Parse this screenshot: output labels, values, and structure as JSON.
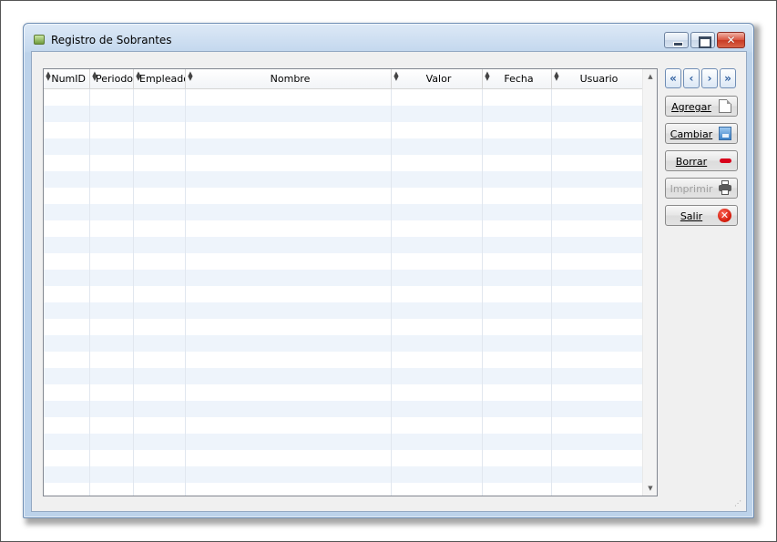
{
  "window": {
    "title": "Registro de Sobrantes",
    "close_glyph": "✕"
  },
  "grid": {
    "columns": [
      {
        "key": "numid",
        "label": "NumID",
        "align": "right"
      },
      {
        "key": "periodo",
        "label": "Periodo",
        "align": "right"
      },
      {
        "key": "empleado",
        "label": "Empleado",
        "align": "right"
      },
      {
        "key": "nombre",
        "label": "Nombre",
        "align": "center"
      },
      {
        "key": "valor",
        "label": "Valor",
        "align": "center"
      },
      {
        "key": "fecha",
        "label": "Fecha",
        "align": "center"
      },
      {
        "key": "usuario",
        "label": "Usuario",
        "align": "center"
      }
    ],
    "rows": []
  },
  "navigation": {
    "first": "«",
    "prev": "‹",
    "next": "›",
    "last": "»"
  },
  "actions": {
    "agregar": "Agregar",
    "cambiar": "Cambiar",
    "borrar": "Borrar",
    "imprimir": "Imprimir",
    "salir": "Salir",
    "salir_icon_glyph": "✕"
  },
  "colors": {
    "row_alt": "#eef4fb",
    "accent": "#2f5f9f",
    "delete_red": "#d8001a"
  }
}
